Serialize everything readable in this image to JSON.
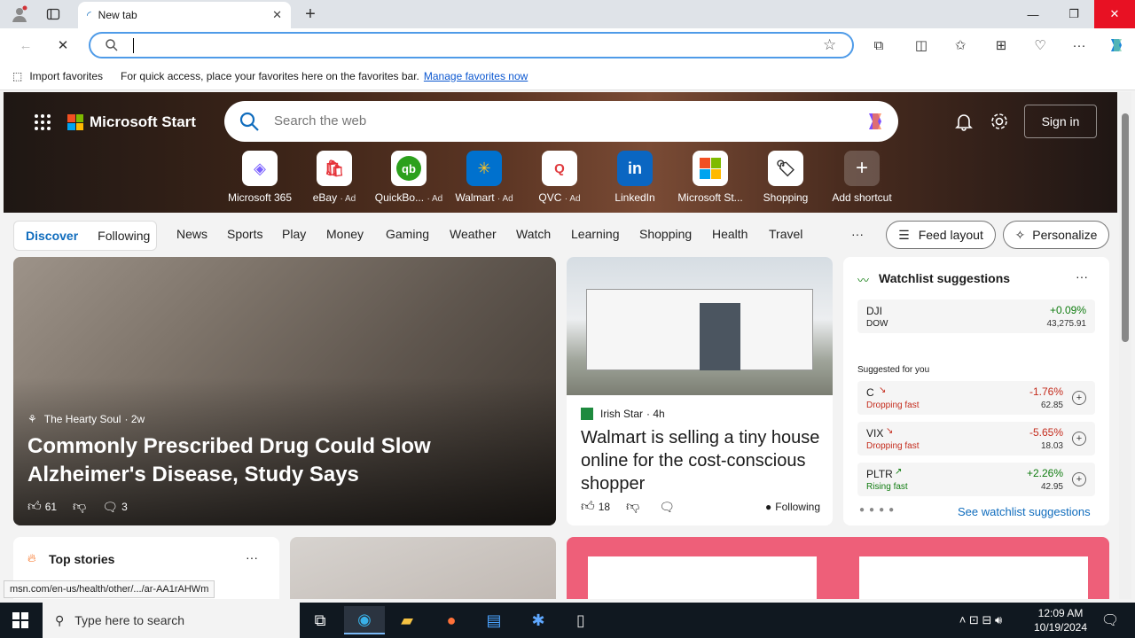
{
  "browser": {
    "tab_title": "New tab",
    "addressbar_value": "",
    "favbar": {
      "import_label": "Import favorites",
      "message": "For quick access, place your favorites here on the favorites bar.",
      "manage_link": "Manage favorites now"
    }
  },
  "page": {
    "brand": "Microsoft Start",
    "search_placeholder": "Search the web",
    "signin_label": "Sign in",
    "shortcuts": [
      {
        "label": "Microsoft 365",
        "ad": ""
      },
      {
        "label": "eBay",
        "ad": "· Ad"
      },
      {
        "label": "QuickBo...",
        "ad": "· Ad"
      },
      {
        "label": "Walmart",
        "ad": "· Ad"
      },
      {
        "label": "QVC",
        "ad": "· Ad"
      },
      {
        "label": "LinkedIn",
        "ad": ""
      },
      {
        "label": "Microsoft St...",
        "ad": ""
      },
      {
        "label": "Shopping",
        "ad": ""
      },
      {
        "label": "Add shortcut",
        "ad": ""
      }
    ],
    "nav": {
      "discover": "Discover",
      "following": "Following",
      "tabs": [
        "News",
        "Sports",
        "Play",
        "Money",
        "Gaming",
        "Weather",
        "Watch",
        "Learning",
        "Shopping",
        "Health",
        "Travel"
      ],
      "more": "···",
      "feed_layout": "Feed layout",
      "personalize": "Personalize"
    },
    "card1": {
      "source": "The Hearty Soul",
      "age": "· 2w",
      "headline": "Commonly Prescribed Drug Could Slow Alzheimer's Disease, Study Says",
      "likes": "61",
      "comments": "3"
    },
    "card2": {
      "source": "Irish Star",
      "age": "· 4h",
      "headline": "Walmart is selling a tiny house online for the cost-conscious shopper",
      "likes": "18",
      "following": "Following"
    },
    "watchlist": {
      "title": "Watchlist suggestions",
      "more": "···",
      "suggested_label": "Suggested for you",
      "see_more": "See watchlist suggestions",
      "stocks": [
        {
          "symbol": "DJI",
          "sub": "DOW",
          "pct": "+0.09%",
          "price": "43,275.91",
          "dir": "up",
          "button": ""
        },
        {
          "symbol": "C",
          "sub": "Dropping fast",
          "pct": "-1.76%",
          "price": "62.85",
          "dir": "down",
          "button": "+"
        },
        {
          "symbol": "VIX",
          "sub": "Dropping fast",
          "pct": "-5.65%",
          "price": "18.03",
          "dir": "down",
          "button": "+"
        },
        {
          "symbol": "PLTR",
          "sub": "Rising fast",
          "pct": "+2.26%",
          "price": "42.95",
          "dir": "up",
          "button": "+"
        }
      ]
    },
    "top_stories": {
      "title": "Top stories",
      "more": "···"
    },
    "status_url": "msn.com/en-us/health/other/.../ar-AA1rAHWm"
  },
  "taskbar": {
    "search_placeholder": "Type here to search",
    "time": "12:09 AM",
    "date": "10/19/2024"
  },
  "colors": {
    "accent": "#0f6cbd",
    "close_red": "#e81123",
    "stock_down": "#c42b1c",
    "stock_up": "#107c10"
  }
}
